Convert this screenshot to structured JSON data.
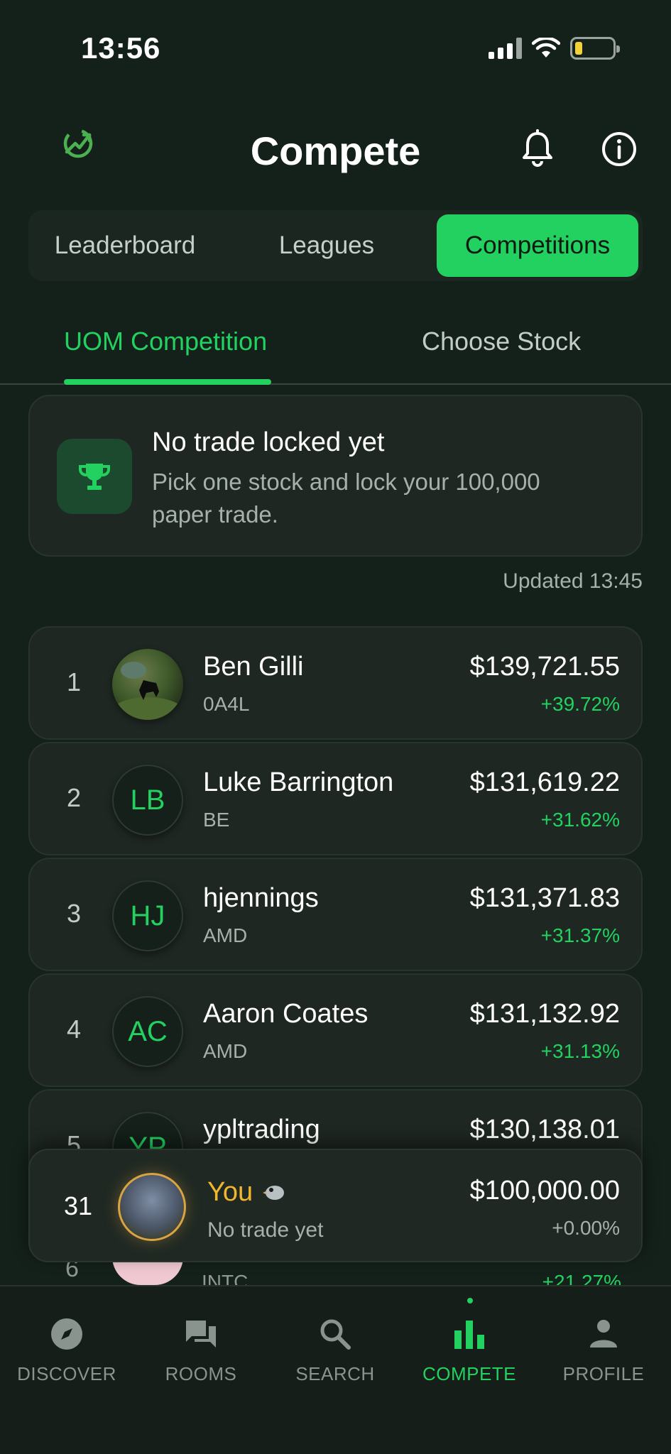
{
  "status_bar": {
    "time": "13:56"
  },
  "header": {
    "title": "Compete",
    "icons": [
      "trend-icon",
      "bell-icon",
      "info-icon"
    ]
  },
  "segments": {
    "leaderboard": "Leaderboard",
    "leagues": "Leagues",
    "competitions": "Competitions",
    "active": "Competitions"
  },
  "subtabs": {
    "competition": "UOM Competition",
    "choose_stock": "Choose Stock",
    "active": "UOM Competition"
  },
  "info_card": {
    "title": "No trade locked yet",
    "subtitle": "Pick one stock and lock your 100,000 paper trade.",
    "icon": "trophy-icon"
  },
  "updated": "Updated 13:45",
  "leaderboard": [
    {
      "rank": "1",
      "name": "Ben Gilli",
      "ticker": "0A4L",
      "value": "$139,721.55",
      "change": "+39.72%",
      "avatar": "photo"
    },
    {
      "rank": "2",
      "name": "Luke Barrington",
      "ticker": "BE",
      "value": "$131,619.22",
      "change": "+31.62%",
      "initials": "LB"
    },
    {
      "rank": "3",
      "name": "hjennings",
      "ticker": "AMD",
      "value": "$131,371.83",
      "change": "+31.37%",
      "initials": "HJ"
    },
    {
      "rank": "4",
      "name": "Aaron Coates",
      "ticker": "AMD",
      "value": "$131,132.92",
      "change": "+31.13%",
      "initials": "AC"
    },
    {
      "rank": "5",
      "name": "ypltrading",
      "value": "$130,138.01",
      "initials": "YP"
    },
    {
      "rank": "6",
      "ticker": "INTC",
      "change": "+21.27%"
    }
  ],
  "you": {
    "rank": "31",
    "name": "You",
    "status": "No trade yet",
    "value": "$100,000.00",
    "change": "+0.00%"
  },
  "nav": {
    "discover": "DISCOVER",
    "rooms": "ROOMS",
    "search": "SEARCH",
    "compete": "COMPETE",
    "profile": "PROFILE",
    "active": "COMPETE"
  },
  "colors": {
    "background": "#14201a",
    "accent": "#22d160",
    "card": "#1e2722",
    "you_highlight": "#f2b62c"
  }
}
